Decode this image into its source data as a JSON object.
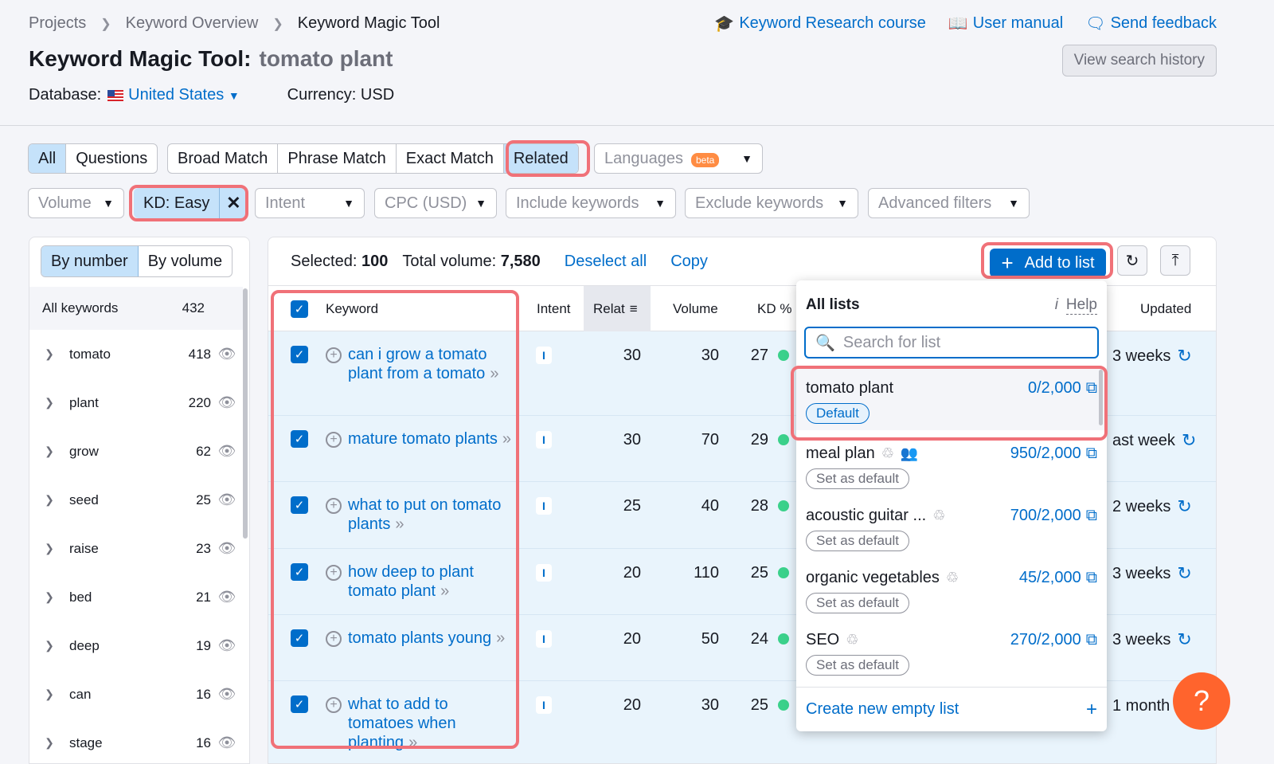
{
  "breadcrumb": [
    "Projects",
    "Keyword Overview",
    "Keyword Magic Tool"
  ],
  "top_links": {
    "course": "Keyword Research course",
    "manual": "User manual",
    "feedback": "Send feedback"
  },
  "title": {
    "label": "Keyword Magic Tool:",
    "query": "tomato plant"
  },
  "view_history": "View search history",
  "database": {
    "label": "Database:",
    "country": "United States",
    "currency": "Currency: USD"
  },
  "match_tabs": {
    "all": "All",
    "questions": "Questions",
    "broad": "Broad Match",
    "phrase": "Phrase Match",
    "exact": "Exact Match",
    "related": "Related"
  },
  "languages": {
    "label": "Languages",
    "badge": "beta"
  },
  "filters": {
    "volume": "Volume",
    "kd": "KD: Easy",
    "intent": "Intent",
    "cpc": "CPC (USD)",
    "include": "Include keywords",
    "exclude": "Exclude keywords",
    "advanced": "Advanced filters"
  },
  "sidebar": {
    "by_number": "By number",
    "by_volume": "By volume",
    "all_label": "All keywords",
    "all_count": "432",
    "groups": [
      {
        "name": "tomato",
        "count": "418"
      },
      {
        "name": "plant",
        "count": "220"
      },
      {
        "name": "grow",
        "count": "62"
      },
      {
        "name": "seed",
        "count": "25"
      },
      {
        "name": "raise",
        "count": "23"
      },
      {
        "name": "bed",
        "count": "21"
      },
      {
        "name": "deep",
        "count": "19"
      },
      {
        "name": "can",
        "count": "16"
      },
      {
        "name": "stage",
        "count": "16"
      }
    ]
  },
  "toolbar": {
    "selected_label": "Selected:",
    "selected_value": "100",
    "volume_label": "Total volume:",
    "volume_value": "7,580",
    "deselect": "Deselect all",
    "copy": "Copy",
    "add_to_list": "Add to list"
  },
  "columns": {
    "keyword": "Keyword",
    "intent": "Intent",
    "related": "Relat",
    "volume": "Volume",
    "kd": "KD %",
    "updated": "Updated"
  },
  "rows": [
    {
      "keyword": "can i grow a tomato plant from a tomato",
      "intent": "I",
      "related": "30",
      "volume": "30",
      "kd": "27",
      "updated": "3 weeks"
    },
    {
      "keyword": "mature tomato plants",
      "intent": "I",
      "related": "30",
      "volume": "70",
      "kd": "29",
      "updated": "ast week"
    },
    {
      "keyword": "what to put on tomato plants",
      "intent": "I",
      "related": "25",
      "volume": "40",
      "kd": "28",
      "updated": "2 weeks"
    },
    {
      "keyword": "how deep to plant tomato plant",
      "intent": "I",
      "related": "20",
      "volume": "110",
      "kd": "25",
      "updated": "3 weeks"
    },
    {
      "keyword": "tomato plants young",
      "intent": "I",
      "related": "20",
      "volume": "50",
      "kd": "24",
      "updated": "3 weeks"
    },
    {
      "keyword": "what to add to tomatoes when planting",
      "intent": "I",
      "related": "20",
      "volume": "30",
      "kd": "25",
      "updated": "1 month"
    }
  ],
  "popover": {
    "heading": "All lists",
    "help": "Help",
    "search_placeholder": "Search for list",
    "lists": [
      {
        "name": "tomato plant",
        "count": "0/2,000",
        "tag": "Default"
      },
      {
        "name": "meal plan",
        "count": "950/2,000",
        "tag": "Set as default"
      },
      {
        "name": "acoustic guitar ...",
        "count": "700/2,000",
        "tag": "Set as default"
      },
      {
        "name": "organic vegetables",
        "count": "45/2,000",
        "tag": "Set as default"
      },
      {
        "name": "SEO",
        "count": "270/2,000",
        "tag": "Set as default"
      }
    ],
    "create": "Create new empty list"
  },
  "help_fab": "?",
  "colors": {
    "accent": "#006dca",
    "highlight": "#f07178",
    "kd_easy": "#3bd18b",
    "fab": "#ff642d"
  }
}
